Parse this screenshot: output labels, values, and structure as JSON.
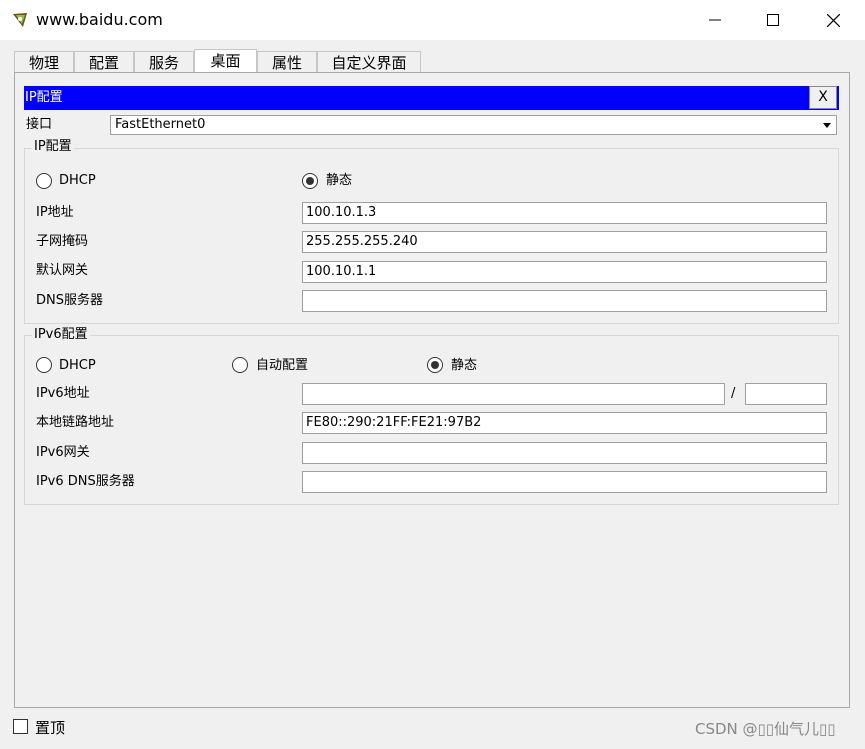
{
  "window": {
    "title": "www.baidu.com"
  },
  "tabs": [
    {
      "label": "物理"
    },
    {
      "label": "配置"
    },
    {
      "label": "服务"
    },
    {
      "label": "桌面",
      "active": true
    },
    {
      "label": "属性"
    },
    {
      "label": "自定义界面"
    }
  ],
  "panel": {
    "header": "IP配置",
    "close_label": "X"
  },
  "interface": {
    "label": "接口",
    "value": "FastEthernet0"
  },
  "ipv4": {
    "title": "IP配置",
    "mode": {
      "dhcp": "DHCP",
      "static": "静态",
      "selected": "static"
    },
    "ip_label": "IP地址",
    "ip_value": "100.10.1.3",
    "mask_label": "子网掩码",
    "mask_value": "255.255.255.240",
    "gateway_label": "默认网关",
    "gateway_value": "100.10.1.1",
    "dns_label": "DNS服务器",
    "dns_value": ""
  },
  "ipv6": {
    "title": "IPv6配置",
    "mode": {
      "dhcp": "DHCP",
      "auto": "自动配置",
      "static": "静态",
      "selected": "static"
    },
    "addr_label": "IPv6地址",
    "addr_value": "",
    "slash": "/",
    "prefix_value": "",
    "linklocal_label": "本地链路地址",
    "linklocal_value": "FE80::290:21FF:FE21:97B2",
    "gateway_label": "IPv6网关",
    "gateway_value": "",
    "dns_label": "IPv6 DNS服务器",
    "dns_value": ""
  },
  "footer": {
    "pin_label": "置顶",
    "watermark": "CSDN @▯▯仙气儿▯▯"
  }
}
